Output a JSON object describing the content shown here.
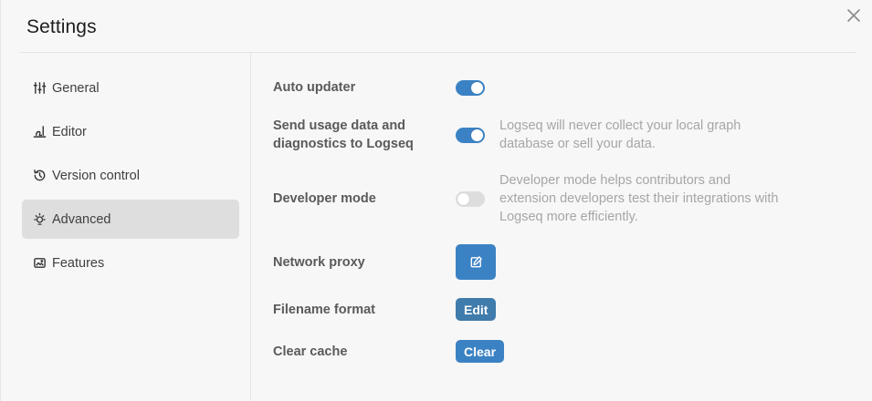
{
  "dialog": {
    "title": "Settings"
  },
  "sidebar": {
    "items": [
      {
        "label": "General",
        "icon": "sliders-icon",
        "active": false
      },
      {
        "label": "Editor",
        "icon": "writing-icon",
        "active": false
      },
      {
        "label": "Version control",
        "icon": "history-icon",
        "active": false
      },
      {
        "label": "Advanced",
        "icon": "bulb-icon",
        "active": true
      },
      {
        "label": "Features",
        "icon": "app-window-icon",
        "active": false
      }
    ]
  },
  "advanced": {
    "auto_updater": {
      "label": "Auto updater",
      "enabled": true
    },
    "usage_data": {
      "label_line1": "Send usage data and",
      "label_line2": "diagnostics to Logseq",
      "enabled": true,
      "desc_line1": "Logseq will never collect your local graph",
      "desc_line2": "database or sell your data."
    },
    "developer_mode": {
      "label": "Developer mode",
      "enabled": false,
      "desc_line1": "Developer mode helps contributors and",
      "desc_line2": "extension developers test their integrations with",
      "desc_line3": "Logseq more efficiently."
    },
    "network_proxy": {
      "label": "Network proxy",
      "button_icon": "edit-icon"
    },
    "filename_format": {
      "label": "Filename format",
      "button_label": "Edit"
    },
    "clear_cache": {
      "label": "Clear cache",
      "button_label": "Clear"
    }
  },
  "colors": {
    "accent": "#3b82c4",
    "edit_button": "#3f7bab",
    "active_nav_bg": "#dedede",
    "toggle_off": "#dddddd",
    "background": "#f7f7f7"
  }
}
